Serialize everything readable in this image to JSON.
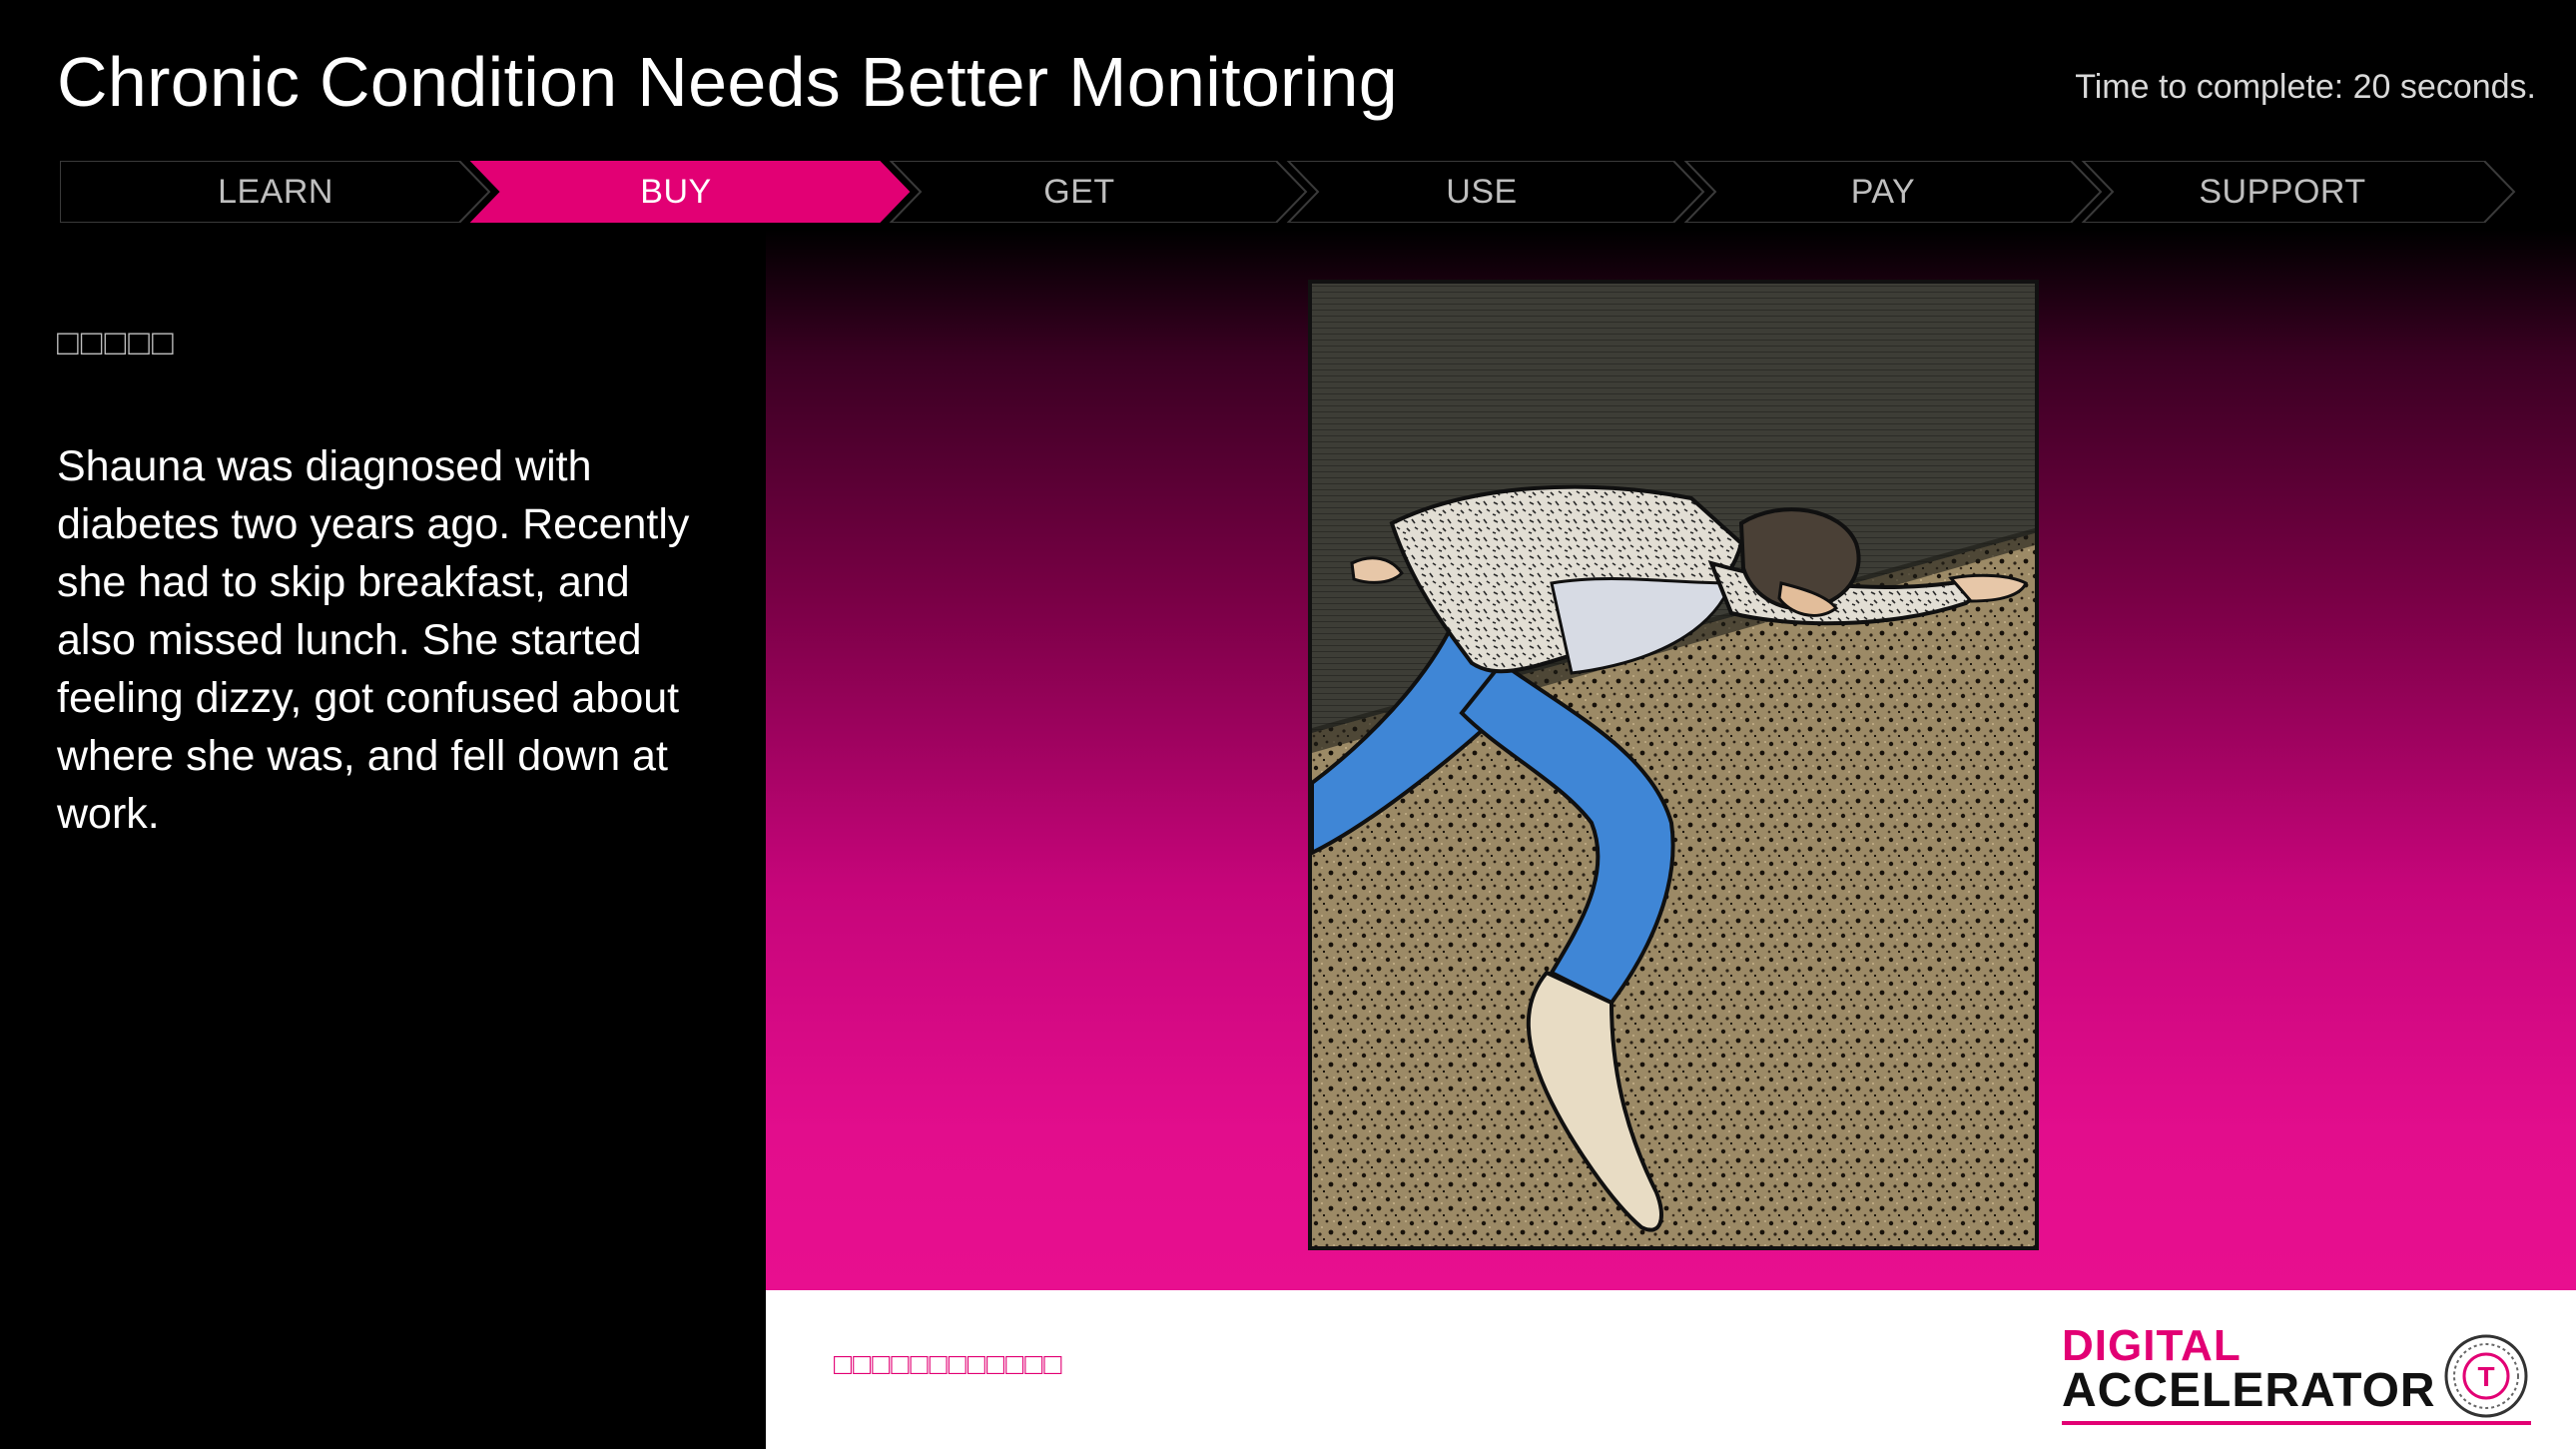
{
  "slide": {
    "title": "Chronic Condition Needs Better Monitoring",
    "time_to_complete": "Time to complete: 20 seconds."
  },
  "journey_steps": [
    {
      "label": "LEARN",
      "active": false
    },
    {
      "label": "BUY",
      "active": true
    },
    {
      "label": "GET",
      "active": false
    },
    {
      "label": "USE",
      "active": false
    },
    {
      "label": "PAY",
      "active": false
    },
    {
      "label": "SUPPORT",
      "active": false
    }
  ],
  "content": {
    "heading_placeholder": "□□□□□",
    "story_text": "Shauna was diagnosed with diabetes two years ago. Recently she had to skip breakfast, and also missed lunch. She started feeling dizzy, got confused about where she was, and fell down at work."
  },
  "footer": {
    "note_placeholder": "□□□□□□□□□□□□",
    "logo_line1": "DIGITAL",
    "logo_line2": "ACCELERATOR",
    "logo_mark": "T"
  },
  "colors": {
    "accent": "#e20074",
    "background": "#000000",
    "footer_background": "#ffffff"
  },
  "icons": {
    "seal": "t-seal-icon"
  }
}
